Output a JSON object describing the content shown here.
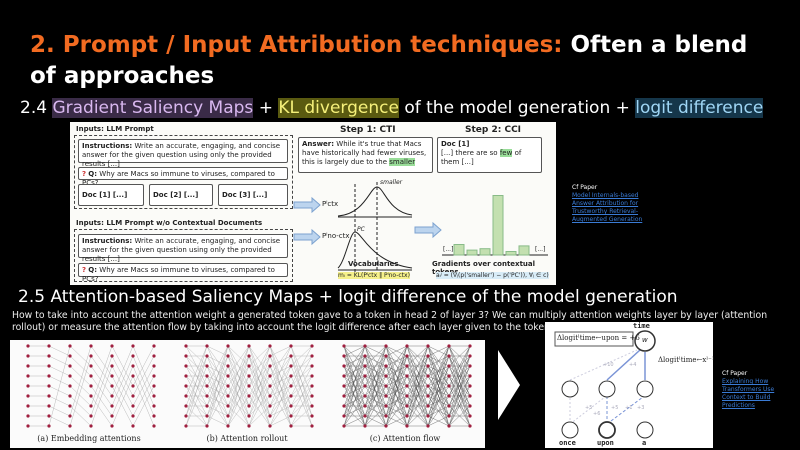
{
  "title": {
    "part1": "2. Prompt / Input Attribution techniques:",
    "part2": "Often a blend of approaches"
  },
  "colors": {
    "accent": "#f26b21",
    "highlight_purple": "#3a2b47",
    "highlight_yellow": "#5a5a10",
    "highlight_blue": "#15364a"
  },
  "section_24": {
    "prefix": "2.4 ",
    "t1": "Gradient Saliency Maps",
    "p1": " + ",
    "t2": "KL divergence",
    "p2": " of the model generation + ",
    "t3": "logit difference"
  },
  "figure1": {
    "inputs_label": "Inputs: LLM Prompt",
    "instructions_bold": "Instructions:",
    "instructions": "Write an accurate, engaging, and concise answer for the given question using only the provided results [...]",
    "q_bold": "Q:",
    "question": "Why are Macs so immune to viruses, compared to PCs?",
    "docs": [
      "Doc [1]  [...]",
      "Doc [2]  [...]",
      "Doc [3]  [...]"
    ],
    "inputs_label2": "Inputs: LLM Prompt w/o Contextual Documents",
    "step1": "Step 1: CTI",
    "step2": "Step 2: CCI",
    "answer_bold": "Answer:",
    "answer": "While it's true that Macs have historically had fewer viruses, this is largely due to the",
    "answer_hl": "smaller",
    "doc1_title": "Doc [1]",
    "doc1_pre": "[...] there are so",
    "doc1_hl": "few",
    "doc1_post": "of them [...]",
    "smaller": "smaller",
    "pc": "PC",
    "p_ctx": "Pˡctx",
    "p_noctx": "Pˡno-ctx",
    "vocab": "Vocabularies",
    "kl": "mᵢ = KL(Pˡctx ‖ Pˡno-ctx)",
    "grad_label": "Gradients over contextual tokens",
    "grad_formula": "aᵢʲ = (∇ⱼ(p('smaller') − p('PC')), ∀ⱼ ∈ c)",
    "bar_values": [
      0.15,
      0.07,
      0.09,
      0.85,
      0.05,
      0.13
    ],
    "ellipsis": "[...]"
  },
  "cf1": {
    "label": "Cf Paper",
    "link": "Model Internals-based Answer Attribution for Trustworthy Retrieval-Augmented Generation"
  },
  "section_25": "2.5 Attention-based Saliency Maps + logit difference of the model generation",
  "description": "How to take into account the attention weight a generated token gave to a token in head 2 of layer 3? We can multiply attention weights layer by layer (attention rollout) or measure the attention flow by taking into account the logit difference after each layer given to the token.",
  "figure2": {
    "captions": [
      "(a) Embedding attentions",
      "(b) Attention rollout",
      "(c) Attention flow"
    ]
  },
  "figure3": {
    "top": "time",
    "tokens": [
      "once",
      "upon",
      "a"
    ],
    "delta_box": "Δlogitˡtime←upon = +6",
    "delta_side": "Δlogitˡtime←xˡ⁻¹",
    "w": "w",
    "edges": [
      "+10",
      "+4",
      "+5",
      "+6",
      "+5",
      "+1",
      "+3"
    ]
  },
  "cf2": {
    "label": "Cf Paper",
    "link": "Explaining How Transformers Use Context to Build Predictions"
  }
}
